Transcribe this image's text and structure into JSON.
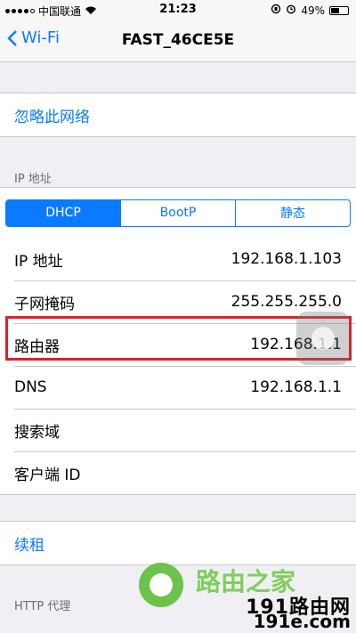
{
  "status_bar": {
    "carrier": "中国联通",
    "time": "21:23",
    "battery": "49%",
    "battery_level": 0.49
  },
  "nav": {
    "back_label": "Wi-Fi",
    "title": "FAST_46CE5E"
  },
  "forget_network": "忽略此网络",
  "ip_section": {
    "header": "IP 地址",
    "segments": [
      "DHCP",
      "BootP",
      "静态"
    ],
    "selected_segment": "DHCP",
    "rows": [
      {
        "label": "IP 地址",
        "value": "192.168.1.103"
      },
      {
        "label": "子网掩码",
        "value": "255.255.255.0"
      },
      {
        "label": "路由器",
        "value": "192.168.1.1"
      },
      {
        "label": "DNS",
        "value": "192.168.1.1"
      },
      {
        "label": "搜索域",
        "value": ""
      },
      {
        "label": "客户端 ID",
        "value": ""
      }
    ]
  },
  "renew_lease": "续租",
  "http_proxy_header": "HTTP 代理",
  "watermark": {
    "text": "路由之家",
    "number_brand": "191路由网",
    "url": "191e.com"
  },
  "colors": {
    "accent": "#0a7aff",
    "highlight": "#d8212c",
    "background": "#efeff4"
  }
}
